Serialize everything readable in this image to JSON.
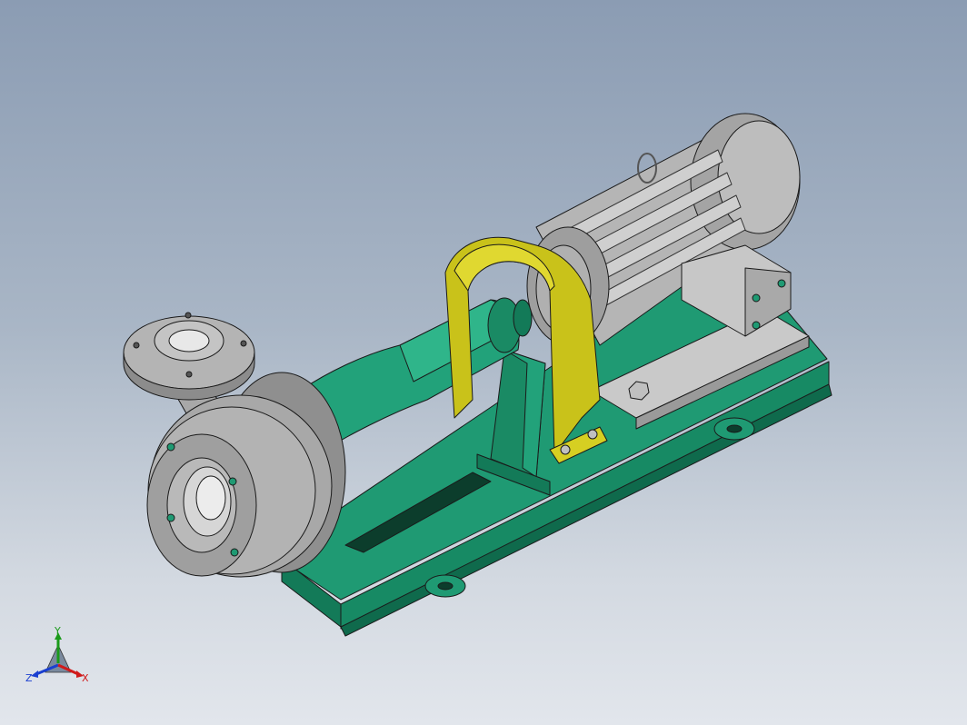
{
  "viewport": {
    "background_top": "#8b9cb3",
    "background_bottom": "#e2e6ec"
  },
  "model": {
    "colors": {
      "base": "#1f9a73",
      "base_dark": "#137a58",
      "casing": "#a8a8a8",
      "motor": "#b5b5b5",
      "guard": "#c9c21a",
      "edge": "#1a1a1a"
    },
    "icons": [
      "pump-casing",
      "suction-flange",
      "discharge-flange",
      "motor",
      "coupling-guard",
      "terminal-box",
      "lifting-eye",
      "base-frame"
    ]
  },
  "triad": {
    "y_label": "Y",
    "z_label": "Z",
    "x_label": "X",
    "y_color": "#1a9a1a",
    "z_color": "#1a3fd0",
    "x_color": "#d01a1a"
  }
}
